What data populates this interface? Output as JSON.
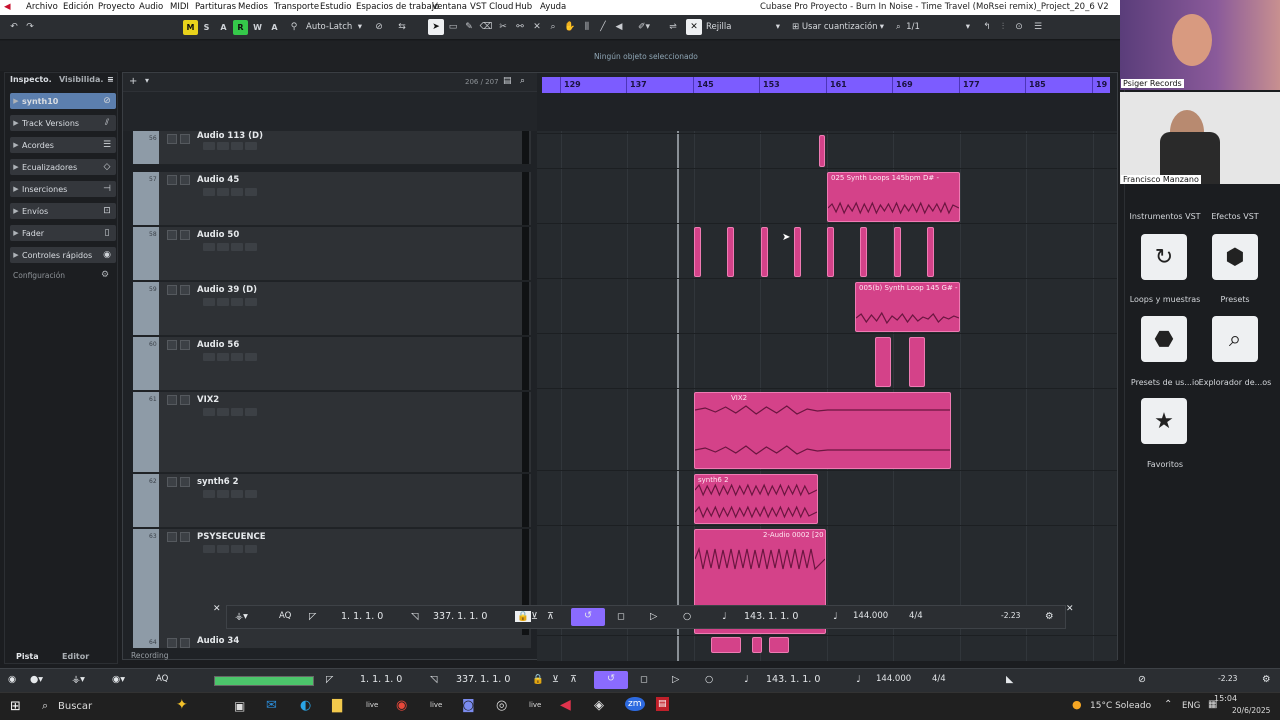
{
  "menubar": {
    "items": [
      "Archivo",
      "Edición",
      "Proyecto",
      "Audio",
      "MIDI",
      "Partituras",
      "Medios",
      "Transporte",
      "Estudio",
      "Espacios de trabajo",
      "Ventana",
      "VST Cloud",
      "Hub",
      "Ayuda"
    ],
    "title": "Cubase Pro Proyecto - Burn In Noise - Time Travel (MoRsei remix)_Project_20_6 V2"
  },
  "toolbar": {
    "m": "M",
    "s": "S",
    "r": "R",
    "w": "W",
    "a": "A",
    "auto_latch": "Auto-Latch",
    "grid": "Rejilla",
    "quant": "Usar cuantización",
    "zoom": "1/1"
  },
  "infobar": {
    "text": "Ningún objeto seleccionado"
  },
  "inspector": {
    "tab1": "Inspecto.",
    "tab2": "Visibilida.",
    "track_name": "synth10",
    "sections": [
      "Track Versions",
      "Acordes",
      "Ecualizadores",
      "Inserciones",
      "Envíos",
      "Fader",
      "Controles rápidos"
    ],
    "config": "Configuración"
  },
  "trackhdr": {
    "count": "206 / 207"
  },
  "ruler": {
    "bars": [
      "129",
      "137",
      "145",
      "153",
      "161",
      "169",
      "177",
      "185",
      "19"
    ]
  },
  "tracks": [
    {
      "num": "56",
      "name": "Audio 113 (D)"
    },
    {
      "num": "57",
      "name": "Audio 45"
    },
    {
      "num": "58",
      "name": "Audio 50"
    },
    {
      "num": "59",
      "name": "Audio 39 (D)"
    },
    {
      "num": "60",
      "name": "Audio 56"
    },
    {
      "num": "61",
      "name": "VIX2"
    },
    {
      "num": "62",
      "name": "synth6 2"
    },
    {
      "num": "63",
      "name": "PSYSECUENCE"
    },
    {
      "num": "64",
      "name": "Audio 34"
    }
  ],
  "clips": {
    "c1": "025 Synth Loops 145bpm D# -",
    "c2": "005(b) Synth Loop 145 G# - 1",
    "c3": "VIX2",
    "c4": "synth6 2",
    "c5": "2-Audio 0002 [20"
  },
  "transport": {
    "aq": "AQ",
    "left": "1. 1. 1. 0",
    "right": "337. 1. 1. 0",
    "pos": "143. 1. 1. 0",
    "tempo": "144.000",
    "sig": "4/4",
    "level": "-2.23"
  },
  "bottom": {
    "tab_pista": "Pista",
    "tab_editor": "Editor",
    "recording": "Recording"
  },
  "rightpanel": {
    "l1": "Instrumentos VST",
    "l2": "Efectos VST",
    "l3": "Loops y muestras",
    "l4": "Presets",
    "l5": "Presets de us...io",
    "l6": "Explorador de...os",
    "l7": "Favoritos"
  },
  "cams": {
    "c1": "Psiger Records",
    "c2": "Francisco Manzano"
  },
  "taskbar": {
    "search": "Buscar",
    "weather": "15°C  Soleado",
    "lang": "ENG",
    "time": "15:04",
    "date": "20/6/2025"
  }
}
